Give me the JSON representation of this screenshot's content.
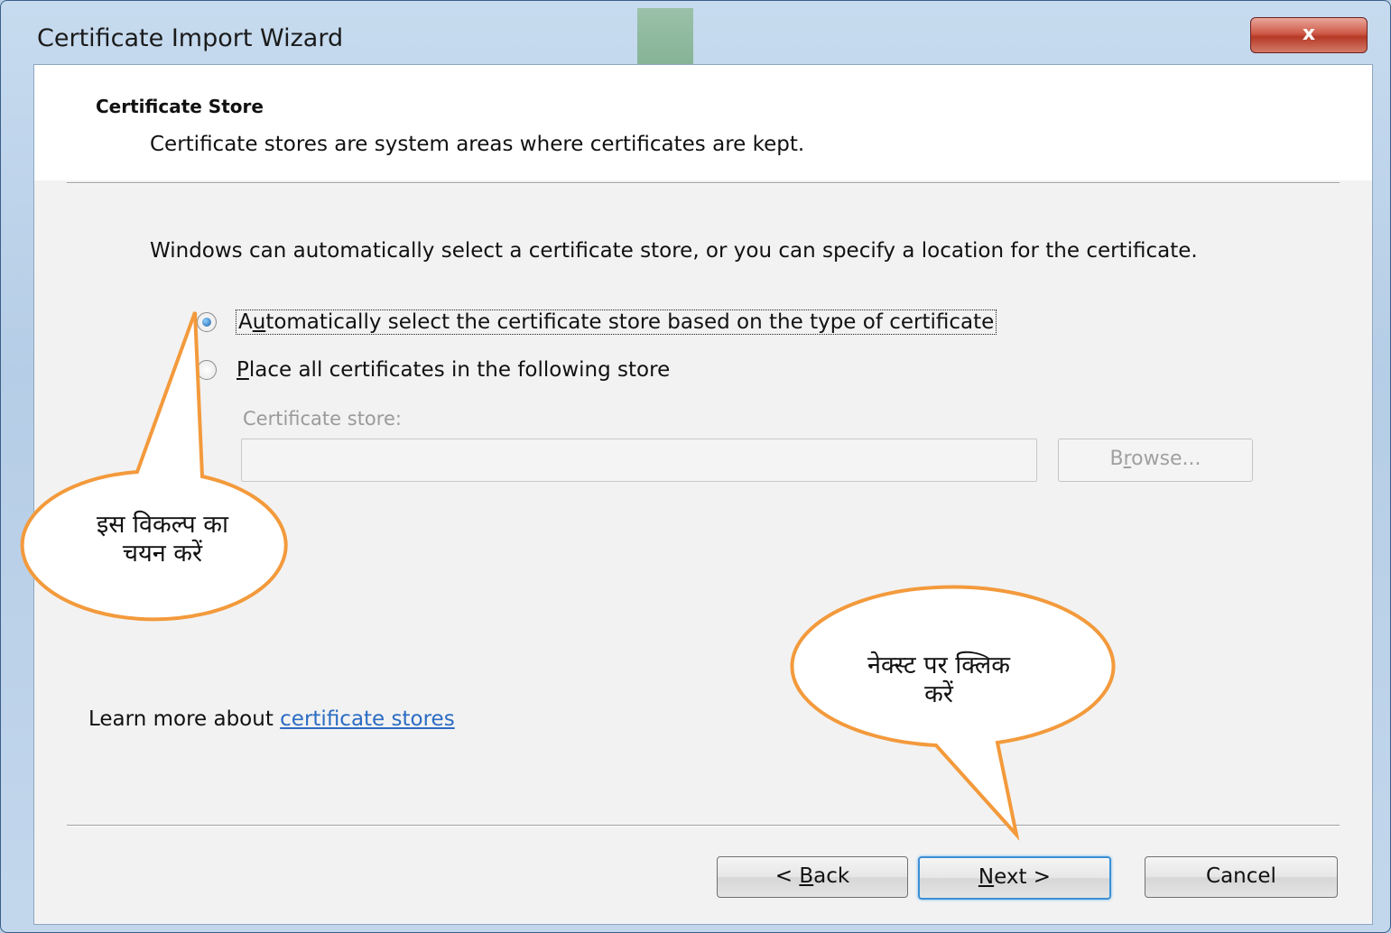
{
  "window": {
    "title": "Certificate Import Wizard",
    "close_label": "x"
  },
  "header": {
    "section_title": "Certificate Store",
    "description": "Certificate stores are system areas where certificates are kept."
  },
  "body": {
    "intro": "Windows can automatically select a certificate store, or you can specify a location for the certificate.",
    "options": [
      {
        "label_first": "A",
        "label_mnemonic": "u",
        "label_rest": "tomatically select the certificate store based on the type of certificate",
        "selected": true
      },
      {
        "label_first": "",
        "label_mnemonic": "P",
        "label_rest": "lace all certificates in the following store",
        "selected": false
      }
    ],
    "store_label": "Certificate store:",
    "store_value": "",
    "browse_first": "B",
    "browse_mnemonic": "r",
    "browse_rest": "owse..."
  },
  "footer": {
    "learn_prefix": "Learn more about ",
    "learn_link": "certificate stores",
    "back_prefix": "< ",
    "back_mnemonic": "B",
    "back_rest": "ack",
    "next_mnemonic": "N",
    "next_rest": "ext >",
    "cancel_label": "Cancel"
  },
  "callouts": {
    "select_option_line1": "इस विकल्प का",
    "select_option_line2": "चयन करें",
    "click_next_line1": "नेक्स्ट पर क्लिक",
    "click_next_line2": "करें"
  },
  "colors": {
    "callout_border": "#f39a3c",
    "link": "#2b6cc4",
    "close_button": "#c9503d"
  }
}
